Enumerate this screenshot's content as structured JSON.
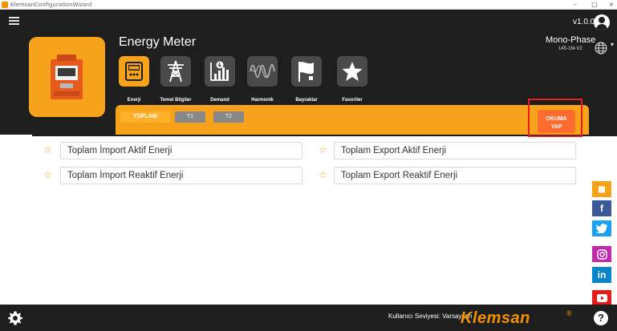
{
  "window": {
    "title": "KlemsanConfigurationWizard",
    "minimize": "–",
    "maximize": "□",
    "close": "×"
  },
  "header": {
    "version": "v1.0.0",
    "device_title": "Energy Meter",
    "phase": "Mono-Phase",
    "model_code": "145-1M-V2",
    "language_caret": "▾"
  },
  "categories": [
    {
      "label": "Enerji",
      "icon": "meter-icon",
      "active": true
    },
    {
      "label": "Temel Bilgiler",
      "icon": "tower-icon",
      "active": false
    },
    {
      "label": "Demand",
      "icon": "demand-chart-icon",
      "active": false
    },
    {
      "label": "Harmonik",
      "icon": "wave-icon",
      "active": false
    },
    {
      "label": "Bayraklar",
      "icon": "flag-icon",
      "active": false
    },
    {
      "label": "Favoriler",
      "icon": "star-icon",
      "active": false
    }
  ],
  "tabs": [
    {
      "label": "TOPLAM",
      "active": true
    },
    {
      "label": "T1",
      "active": false
    },
    {
      "label": "T2",
      "active": false
    }
  ],
  "read_button": {
    "line1": "OKUMA",
    "line2": "YAP"
  },
  "fields": [
    {
      "label": "Toplam İmport Aktif Enerji",
      "star": "☆"
    },
    {
      "label": "Toplam Export Aktif Enerji",
      "star": "☆"
    },
    {
      "label": "Toplam İmport Reaktif Enerji",
      "star": "☆"
    },
    {
      "label": "Toplam Export Reaktif Enerji",
      "star": "☆"
    }
  ],
  "social": [
    {
      "name": "site-icon",
      "glyph": "▦"
    },
    {
      "name": "facebook-icon",
      "glyph": "f"
    },
    {
      "name": "twitter-icon",
      "glyph": "🐦"
    },
    {
      "name": "instagram-icon",
      "glyph": "◎"
    },
    {
      "name": "linkedin-icon",
      "glyph": "in"
    },
    {
      "name": "youtube-icon",
      "glyph": "▶"
    }
  ],
  "footer": {
    "user_level": "Kullanıcı Seviyesi: Varsayılan",
    "brand": "Klemsan",
    "brand_reg": "®",
    "help": "?"
  },
  "colors": {
    "accent": "#f6a21a",
    "dark": "#1e1e1e",
    "read_button": "#ff6a2e",
    "highlight": "#e81d1d"
  }
}
